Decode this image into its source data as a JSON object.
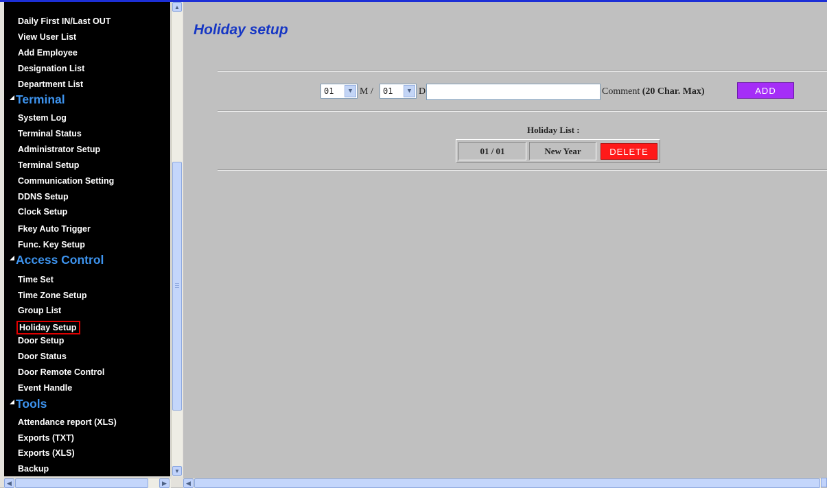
{
  "sidebar": {
    "items": [
      {
        "kind": "link",
        "label": "Daily First IN/Last OUT"
      },
      {
        "kind": "link",
        "label": "View User List"
      },
      {
        "kind": "link",
        "label": "Add Employee"
      },
      {
        "kind": "link",
        "label": "Designation List"
      },
      {
        "kind": "link",
        "label": "Department List"
      },
      {
        "kind": "section",
        "label": "Terminal"
      },
      {
        "kind": "link",
        "label": "System Log"
      },
      {
        "kind": "link",
        "label": "Terminal Status"
      },
      {
        "kind": "link",
        "label": "Administrator Setup"
      },
      {
        "kind": "link",
        "label": "Terminal Setup"
      },
      {
        "kind": "link",
        "label": "Communication Setting"
      },
      {
        "kind": "link",
        "label": "DDNS Setup"
      },
      {
        "kind": "link",
        "label": "Clock Setup"
      },
      {
        "kind": "link",
        "label": "Fkey Auto Trigger"
      },
      {
        "kind": "link",
        "label": "Func. Key Setup"
      },
      {
        "kind": "section",
        "label": "Access Control"
      },
      {
        "kind": "link",
        "label": "Time Set"
      },
      {
        "kind": "link",
        "label": "Time Zone Setup"
      },
      {
        "kind": "link",
        "label": "Group List"
      },
      {
        "kind": "link",
        "label": "Holiday Setup",
        "selected": true
      },
      {
        "kind": "link",
        "label": "Door Setup"
      },
      {
        "kind": "link",
        "label": "Door Status"
      },
      {
        "kind": "link",
        "label": "Door Remote Control"
      },
      {
        "kind": "link",
        "label": "Event Handle"
      },
      {
        "kind": "section",
        "label": "Tools"
      },
      {
        "kind": "link",
        "label": "Attendance report (XLS)"
      },
      {
        "kind": "link",
        "label": "Exports (TXT)"
      },
      {
        "kind": "link",
        "label": "Exports (XLS)"
      },
      {
        "kind": "link",
        "label": "Backup"
      }
    ]
  },
  "main": {
    "title": "Holiday setup",
    "form": {
      "month_value": "01",
      "month_label": "M /",
      "day_value": "01",
      "day_label": "D",
      "comment_value": "",
      "comment_label": "Comment",
      "comment_hint": "(20 Char. Max)",
      "add_label": "ADD"
    },
    "holiday_list": {
      "title": "Holiday List :",
      "rows": [
        {
          "date": "01 / 01",
          "name": "New Year",
          "delete_label": "DELETE"
        }
      ]
    }
  },
  "colors": {
    "accent_title": "#1737c4",
    "section_text": "#3d93ee",
    "add_button": "#a52ef7",
    "delete_button": "#ff1a1a",
    "selected_outline": "#e00000"
  }
}
